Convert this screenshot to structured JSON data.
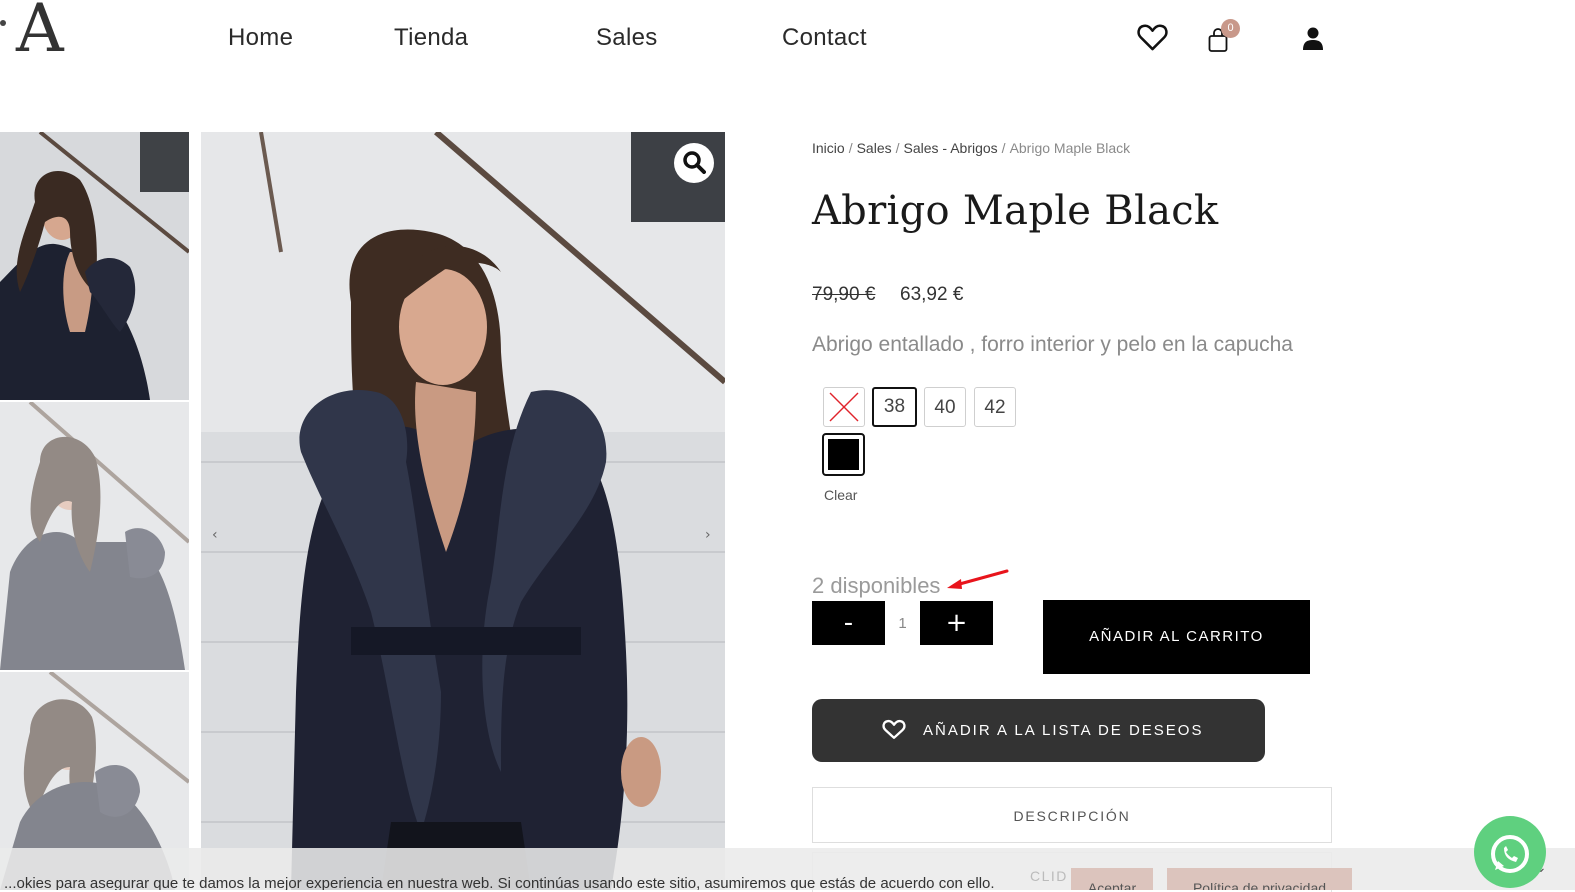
{
  "header": {
    "logo": "A",
    "nav": [
      {
        "label": "Home"
      },
      {
        "label": "Tienda"
      },
      {
        "label": "Sales"
      },
      {
        "label": "Contact"
      }
    ],
    "icons": [
      "heart-icon",
      "shopping-bag-icon",
      "user-icon"
    ],
    "cart_count": "0",
    "badge_color": "#c8988a"
  },
  "gallery": {
    "zoom_icon": "magnifier-icon",
    "prev_arrow": "‹",
    "next_arrow": "›"
  },
  "breadcrumb": {
    "items": [
      "Inicio",
      "Sales",
      "Sales - Abrigos"
    ],
    "current": "Abrigo Maple Black",
    "separator": "/"
  },
  "product": {
    "title": "Abrigo Maple Black",
    "price_old": "79,90 €",
    "price_new": "63,92 €",
    "short_description": "Abrigo entallado , forro interior y pelo en la capucha",
    "sizes": [
      "38",
      "40",
      "42"
    ],
    "selected_size": "38",
    "selected_color": "#000000",
    "clear_label": "Clear",
    "stock": "2 disponibles",
    "qty_minus": "-",
    "qty_value": "1",
    "qty_plus": "+",
    "add_to_cart": "AÑADIR AL CARRITO",
    "wishlist": "AÑADIR A LA LISTA DE DESEOS",
    "tab_description": "DESCRIPCIÓN"
  },
  "cookie": {
    "text": "...okies para asegurar que te damos la mejor experiencia en nuestra web. Si continúas usando este sitio, asumiremos que estás de acuerdo con ello.",
    "hidden_label": "CLID",
    "accept": "Aceptar",
    "policy": "Política de privacidad"
  },
  "accent": {
    "annotation_arrow": "#e8141c",
    "whatsapp_green": "#5fd07f"
  }
}
